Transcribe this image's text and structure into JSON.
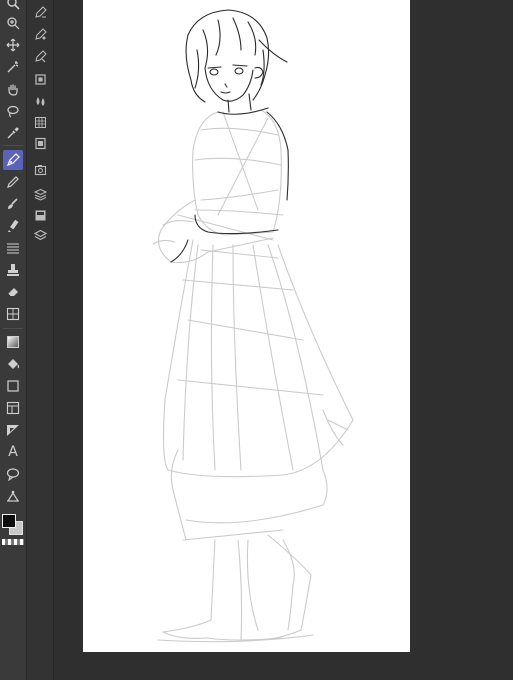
{
  "app": {
    "tab_label": "",
    "accent_color": "#5b63b7"
  },
  "toolbar": {
    "tools": [
      {
        "name": "zoom",
        "icon": "zoom-icon",
        "active": false
      },
      {
        "name": "navigator-zoom",
        "icon": "navigator-zoom-icon",
        "active": false
      },
      {
        "name": "move",
        "icon": "move-icon",
        "active": false
      },
      {
        "name": "select-magic",
        "icon": "magic-wand-icon",
        "active": false
      },
      {
        "name": "hand",
        "icon": "hand-icon",
        "active": false
      },
      {
        "name": "lasso",
        "icon": "lasso-icon",
        "active": false
      },
      {
        "name": "eyedropper",
        "icon": "eyedropper-icon",
        "active": false
      },
      {
        "name": "pen",
        "icon": "pen-icon",
        "active": true
      },
      {
        "name": "pencil",
        "icon": "pencil-icon",
        "active": false
      },
      {
        "name": "brush",
        "icon": "brush-icon",
        "active": false
      },
      {
        "name": "marker",
        "icon": "marker-icon",
        "active": false
      },
      {
        "name": "line",
        "icon": "line-icon",
        "active": false
      },
      {
        "name": "stamp",
        "icon": "stamp-icon",
        "active": false
      },
      {
        "name": "eraser",
        "icon": "eraser-icon",
        "active": false
      },
      {
        "name": "transform",
        "icon": "transform-icon",
        "active": false
      },
      {
        "name": "gradient",
        "icon": "gradient-icon",
        "active": false
      },
      {
        "name": "fill",
        "icon": "fill-bucket-icon",
        "active": false
      },
      {
        "name": "shape",
        "icon": "rectangle-shape-icon",
        "active": false
      },
      {
        "name": "frame",
        "icon": "frame-icon",
        "active": false
      },
      {
        "name": "ruler",
        "icon": "ruler-icon",
        "active": false
      },
      {
        "name": "text",
        "icon": "text-icon",
        "active": false,
        "label": "A"
      },
      {
        "name": "balloon",
        "icon": "balloon-icon",
        "active": false
      },
      {
        "name": "correct-line",
        "icon": "correct-line-icon",
        "active": false
      }
    ]
  },
  "subtools": [
    {
      "icon": "subtool-gpen-icon"
    },
    {
      "icon": "subtool-mapping-pen-icon"
    },
    {
      "icon": "subtool-marker-pen-icon"
    },
    {
      "icon": "subtool-layer-icon"
    },
    {
      "icon": "subtool-ink-drop-icon"
    },
    {
      "icon": "subtool-texture-icon"
    },
    {
      "icon": "subtool-film-icon"
    },
    {
      "icon": "subtool-camera-icon"
    },
    {
      "icon": "subtool-stack-icon"
    },
    {
      "icon": "subtool-panel-icon"
    },
    {
      "icon": "subtool-layers-icon"
    }
  ],
  "colors": {
    "foreground": "#0d0d0d",
    "background": "#c8c8c8",
    "canvas": "#ffffff",
    "sketch_light": "#c9c9c9",
    "sketch_dark": "#2a2a2a"
  }
}
